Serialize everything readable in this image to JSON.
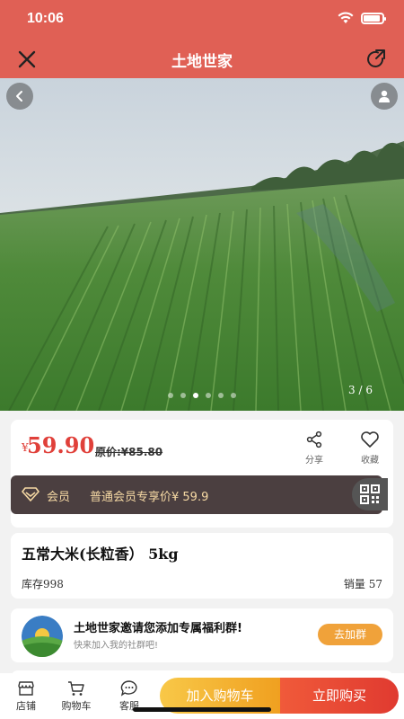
{
  "status_bar": {
    "time": "10:06",
    "battery_level_percent": 90
  },
  "nav": {
    "title": "土地世家",
    "icons": [
      "close-icon",
      "share-arrow-icon"
    ]
  },
  "gallery": {
    "counter": "3 / 6",
    "current_index": 3,
    "total": 6,
    "icons": [
      "back-icon",
      "user-icon"
    ]
  },
  "price": {
    "currency": "¥",
    "value": "59.90",
    "original": "原价:¥85.80",
    "share_label": "分享",
    "favorite_label": "收藏"
  },
  "member": {
    "label": "会员",
    "text": "普通会员专享价¥ 59.9",
    "icons": [
      "diamond-icon",
      "qrcode-icon"
    ]
  },
  "product": {
    "title": "五常大米(长粒香） 5kg",
    "stock": "库存998",
    "sales": "销量 57"
  },
  "group": {
    "title": "土地世家邀请您添加专属福利群!",
    "subtitle": "快来加入我的社群吧!",
    "join_label": "去加群"
  },
  "bottom": {
    "tabs": [
      {
        "label": "店铺",
        "icon": "store-icon"
      },
      {
        "label": "购物车",
        "icon": "cart-icon"
      },
      {
        "label": "客服",
        "icon": "chat-icon"
      }
    ],
    "add_to_cart": "加入购物车",
    "buy_now": "立即购买"
  },
  "colors": {
    "brand": "#e06055",
    "price": "#e0403a",
    "member_bg": "#4b3f40",
    "gold": "#f0a23a"
  }
}
